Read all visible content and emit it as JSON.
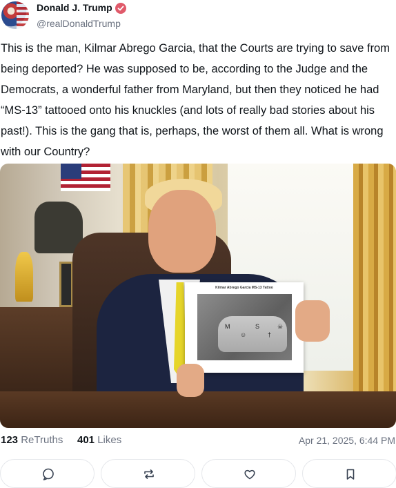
{
  "author": {
    "display_name": "Donald J. Trump",
    "handle": "@realDonaldTrump",
    "avatar_icon": "avatar-photo",
    "verified_icon": "verified-badge-icon",
    "verified_color": "#e05a6a"
  },
  "post": {
    "text": "This is the man, Kilmar Abrego Garcia, that the Courts are trying to save from being deported? He was supposed to be, according to the Judge and the Democrats, a wonderful father from Maryland, but then they noticed he had “MS-13” tattooed onto his knuckles (and lots of really bad stories about his past!). This is the gang that is, perhaps, the worst of them all. What is wrong with our Country?",
    "image": {
      "held_paper_caption": "Kilmar Abrego Garcia MS-13 Tattoo",
      "tattoo_symbols": [
        "M",
        "☺",
        "S",
        "†",
        "☠"
      ]
    }
  },
  "stats": {
    "retruths_count": "123",
    "retruths_label": "ReTruths",
    "likes_count": "401",
    "likes_label": "Likes",
    "timestamp": "Apr 21, 2025, 6:44 PM"
  },
  "actions": [
    {
      "icon": "reply-icon"
    },
    {
      "icon": "retruth-icon"
    },
    {
      "icon": "like-icon"
    },
    {
      "icon": "bookmark-icon"
    }
  ]
}
